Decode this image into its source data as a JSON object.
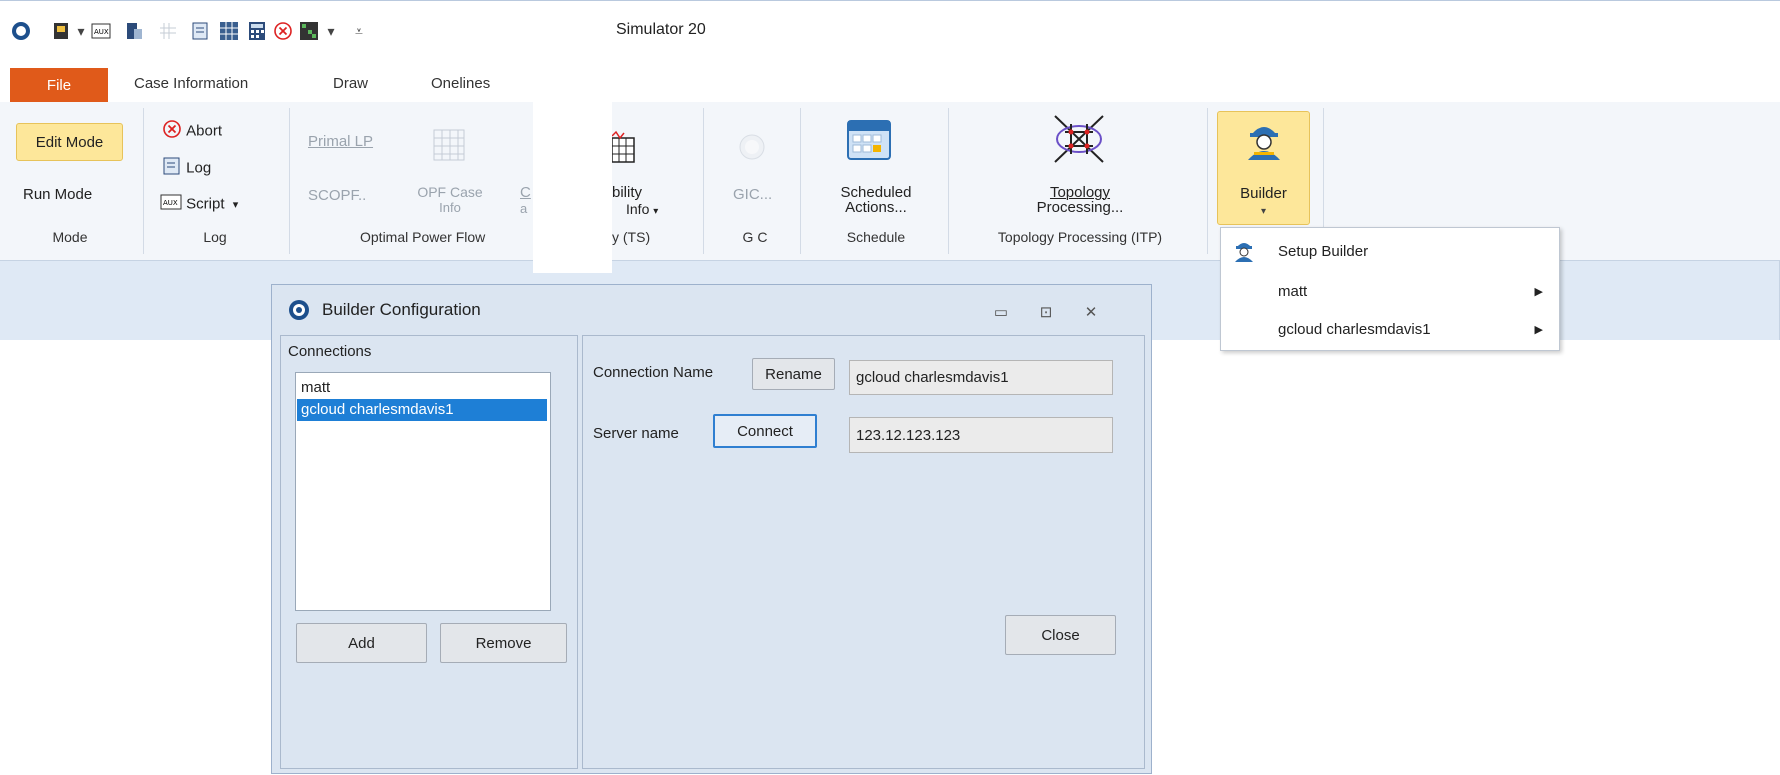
{
  "app": {
    "title": "Simulator 20",
    "qat_icons": [
      "app-logo-icon",
      "open-icon",
      "dropdown-arrow-icon",
      "auxb-icon",
      "case-icon",
      "grid-icon",
      "log-icon",
      "table-icon",
      "calculator-icon",
      "abort-icon",
      "matrix-icon",
      "dropdown-arrow-icon",
      "customize-icon"
    ]
  },
  "tabs": {
    "file": "File",
    "items": [
      "Case Information",
      "Draw",
      "Onelines"
    ]
  },
  "ribbon": {
    "mode": {
      "edit": "Edit Mode",
      "run": "Run Mode",
      "label": "Mode"
    },
    "log": {
      "abort": "Abort",
      "log": "Log",
      "script": "Script",
      "label": "Log"
    },
    "opf": {
      "primal": "Primal LP",
      "scopf": "SCOPF..",
      "opf_case_1": "OPF Case",
      "opf_case_2": "Info",
      "c1": "C",
      "c2": "a",
      "label": "Optimal Power Flow"
    },
    "ts": {
      "line1": "bility",
      "line2": "Info",
      "label": "y (TS)"
    },
    "gic": {
      "name": "GIC...",
      "label": "G C"
    },
    "schedule": {
      "line1": "Scheduled",
      "line2": "Actions...",
      "label": "Schedule"
    },
    "topology": {
      "line1": "Topology",
      "line2": "Processing...",
      "label": "Topology Processing (ITP)"
    },
    "builder": {
      "label": "Builder"
    }
  },
  "menu": {
    "setup": "Setup Builder",
    "items": [
      "matt",
      "gcloud charlesmdavis1"
    ]
  },
  "dialog": {
    "title": "Builder Configuration",
    "connections_label": "Connections",
    "connections": [
      "matt",
      "gcloud charlesmdavis1"
    ],
    "selected_index": 1,
    "add": "Add",
    "remove": "Remove",
    "connection_name_label": "Connection Name",
    "rename": "Rename",
    "connection_name_value": "gcloud charlesmdavis1",
    "server_name_label": "Server name",
    "connect": "Connect",
    "server_name_value": "123.12.123.123",
    "close": "Close"
  },
  "colors": {
    "file_tab": "#e05a1a",
    "highlight": "#fde79a",
    "selection": "#1e7fd6"
  }
}
